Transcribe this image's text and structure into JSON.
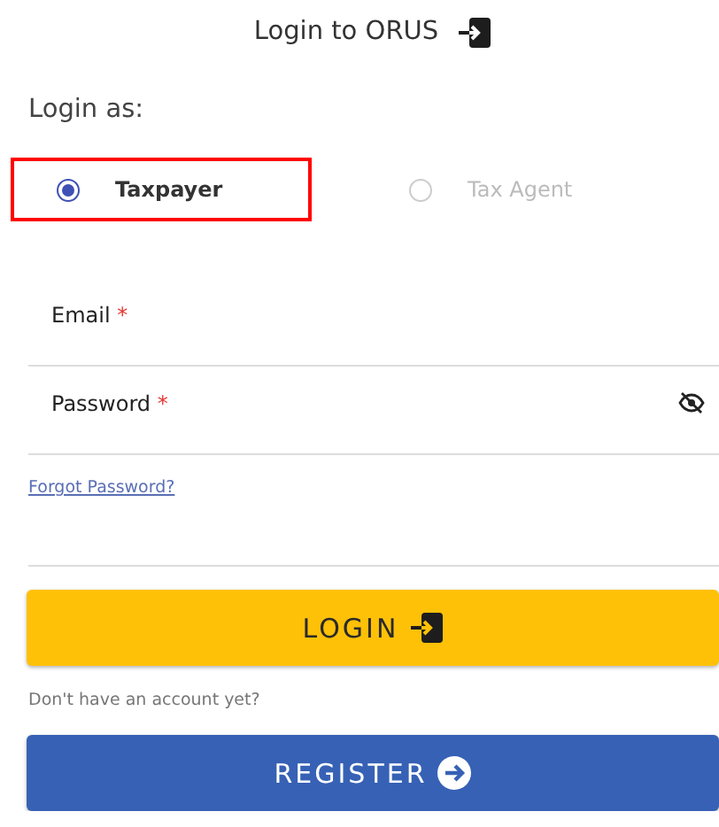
{
  "header": {
    "title": "Login to ORUS"
  },
  "login_as": {
    "label": "Login as:",
    "options": [
      {
        "label": "Taxpayer",
        "selected": true,
        "disabled": false,
        "highlighted": true
      },
      {
        "label": "Tax Agent",
        "selected": false,
        "disabled": true,
        "highlighted": false
      }
    ]
  },
  "fields": [
    {
      "label": "Email",
      "required": "*",
      "kind": "text"
    },
    {
      "label": "Password",
      "required": "*",
      "kind": "password"
    }
  ],
  "forgot_link": "Forgot Password?",
  "login_button": {
    "label": "LOGIN",
    "kind": "primary"
  },
  "register_prompt": "Don't have an account yet?",
  "register_button": {
    "label": "REGISTER",
    "kind": "secondary"
  }
}
